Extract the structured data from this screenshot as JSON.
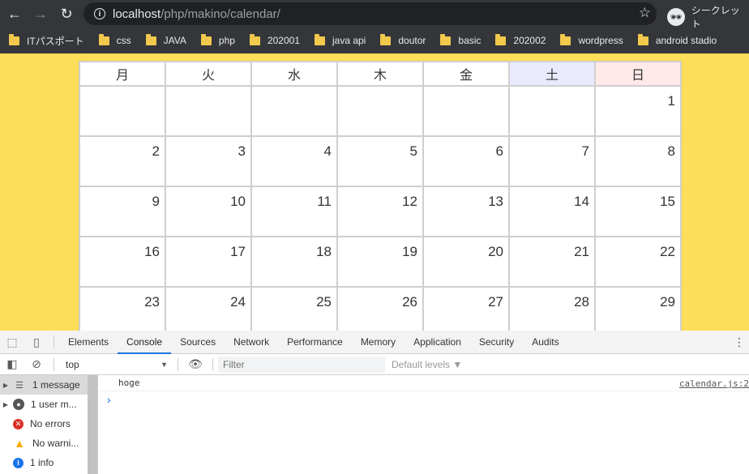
{
  "browser": {
    "back": "←",
    "forward": "→",
    "reload": "↻",
    "url_host": "localhost",
    "url_path": "/php/makino/calendar/",
    "star": "☆",
    "incognito_label": "シークレット"
  },
  "bookmarks": [
    "ITパスポート",
    "css",
    "JAVA",
    "php",
    "202001",
    "java api",
    "doutor",
    "basic",
    "202002",
    "wordpress",
    "android stadio"
  ],
  "calendar": {
    "headers": [
      "月",
      "火",
      "水",
      "木",
      "金",
      "土",
      "日"
    ],
    "weeks": [
      [
        "",
        "",
        "",
        "",
        "",
        "",
        "1"
      ],
      [
        "2",
        "3",
        "4",
        "5",
        "6",
        "7",
        "8"
      ],
      [
        "9",
        "10",
        "11",
        "12",
        "13",
        "14",
        "15"
      ],
      [
        "16",
        "17",
        "18",
        "19",
        "20",
        "21",
        "22"
      ],
      [
        "23",
        "24",
        "25",
        "26",
        "27",
        "28",
        "29"
      ]
    ]
  },
  "devtools": {
    "tabs": [
      "Elements",
      "Console",
      "Sources",
      "Network",
      "Performance",
      "Memory",
      "Application",
      "Security",
      "Audits"
    ],
    "active_tab": "Console",
    "context": "top",
    "filter_placeholder": "Filter",
    "levels": "Default levels ▼",
    "sidebar": [
      {
        "label": "1 message",
        "icon": "list-icon"
      },
      {
        "label": "1 user m...",
        "icon": "user-icon"
      },
      {
        "label": "No errors",
        "icon": "error-icon"
      },
      {
        "label": "No warni...",
        "icon": "warning-icon"
      },
      {
        "label": "1 info",
        "icon": "info-icon"
      }
    ],
    "messages": [
      {
        "text": "hoge",
        "source": "calendar.js:2"
      }
    ],
    "prompt": "›"
  }
}
